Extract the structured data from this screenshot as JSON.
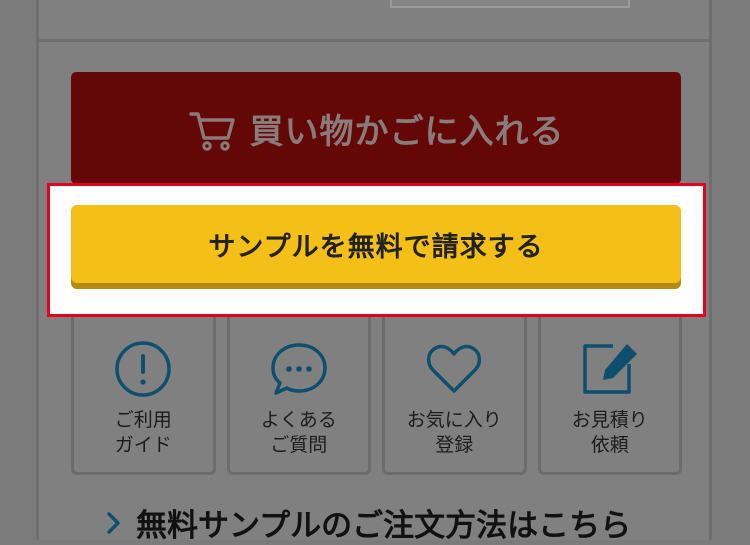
{
  "cart_button": {
    "label": "買い物かごに入れる",
    "icon": "cart-icon"
  },
  "sample_button": {
    "label": "サンプルを無料で請求する"
  },
  "tiles": [
    {
      "label": "ご利用\nガイド",
      "icon": "info-icon"
    },
    {
      "label": "よくある\nご質問",
      "icon": "chat-icon"
    },
    {
      "label": "お気に入り\n登録",
      "icon": "heart-icon"
    },
    {
      "label": "お見積り\n依頼",
      "icon": "edit-icon"
    }
  ],
  "bottom_link": {
    "label": "無料サンプルのご注文方法はこちら",
    "icon": "chevron-right-icon"
  },
  "colors": {
    "cart_bg": "#630707",
    "sample_bg": "#f4bf16",
    "highlight_border": "#e6001c",
    "icon_teal": "#0e4f6e"
  }
}
